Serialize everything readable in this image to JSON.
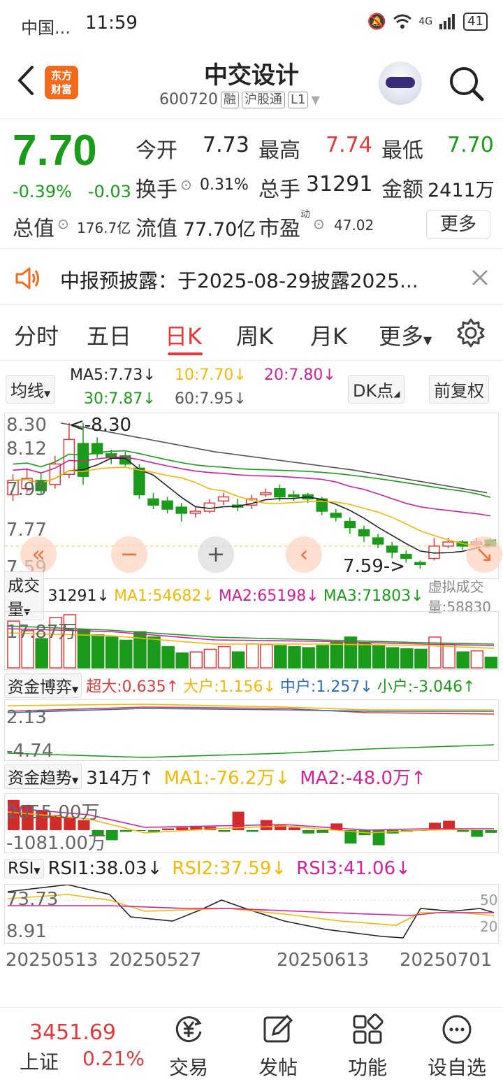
{
  "status": {
    "carrier": "中国...",
    "time": "11:59",
    "network": "4G",
    "battery": "41"
  },
  "header": {
    "title": "中交设计",
    "code": "600720",
    "tags": [
      "融",
      "沪股通",
      "L1"
    ],
    "logo": "东方财富"
  },
  "quote": {
    "price": "7.70",
    "change_pct": "-0.39%",
    "change": "-0.03",
    "open_label": "今开",
    "open": "7.73",
    "high_label": "最高",
    "high": "7.74",
    "low_label": "最低",
    "low": "7.70",
    "turnover_label": "换手",
    "turnover": "0.31%",
    "volume_label": "总手",
    "volume": "31291",
    "amount_label": "金额",
    "amount": "2411万",
    "mktcap_label": "总值",
    "mktcap": "176.7亿",
    "float_label": "流值",
    "float": "77.70亿",
    "pe_label": "市盈",
    "pe_sup": "动",
    "pe": "47.02",
    "more_label": "更多"
  },
  "notice": {
    "text": "中报预披露：于2025-08-29披露2025..."
  },
  "tabs": [
    "分时",
    "五日",
    "日K",
    "周K",
    "月K",
    "更多"
  ],
  "active_tab": 2,
  "ma_legend": {
    "selector": "均线",
    "ma5": "MA5:7.73",
    "ma10": "10:7.70",
    "ma20": "20:7.80",
    "ma30": "30:7.87",
    "ma60": "60:7.95",
    "dk": "DK点",
    "adjust": "前复权",
    "colors": {
      "ma5": "#222222",
      "ma10": "#f5b800",
      "ma20": "#d0209a",
      "ma30": "#1a9b1a",
      "ma60": "#555555"
    }
  },
  "kline": {
    "y_labels": [
      "8.30",
      "8.12",
      "7.95",
      "7.77",
      "7.59"
    ],
    "high_mark": "<-8.30",
    "low_mark": "7.59->",
    "up_color": "#e4393c",
    "down_color": "#1a9b1a"
  },
  "volume_panel": {
    "selector": "成交量",
    "value": "31291",
    "ma1": "MA1:54682",
    "ma2": "MA2:65198",
    "ma3": "MA3:71803",
    "virtual": "虚拟成交量:58830",
    "axis": "17.87万"
  },
  "fund_game": {
    "selector": "资金博弈",
    "super": "超大:0.635",
    "large": "大户:1.156",
    "medium": "中户:1.257",
    "small": "小户:-3.046",
    "axis_top": "2.13",
    "axis_bottom": "-4.74"
  },
  "fund_trend": {
    "selector": "资金趋势",
    "value": "314万",
    "ma1": "MA1:-76.2万",
    "ma2": "MA2:-48.0万",
    "axis_top": "2055.00万",
    "axis_bottom": "-1081.00万"
  },
  "rsi": {
    "selector": "RSI",
    "rsi1": "RSI1:38.03",
    "rsi2": "RSI2:37.59",
    "rsi3": "RSI3:41.06",
    "axis_top": "73.73",
    "axis_bottom": "8.91",
    "right_top": "50",
    "right_bottom": "20"
  },
  "dates": [
    "20250513",
    "20250527",
    "20250613",
    "20250701"
  ],
  "bottom_bar": {
    "index_value": "3451.69",
    "index_name": "上证",
    "index_change": "0.21%",
    "items": [
      "交易",
      "发帖",
      "功能",
      "设自选"
    ]
  }
}
